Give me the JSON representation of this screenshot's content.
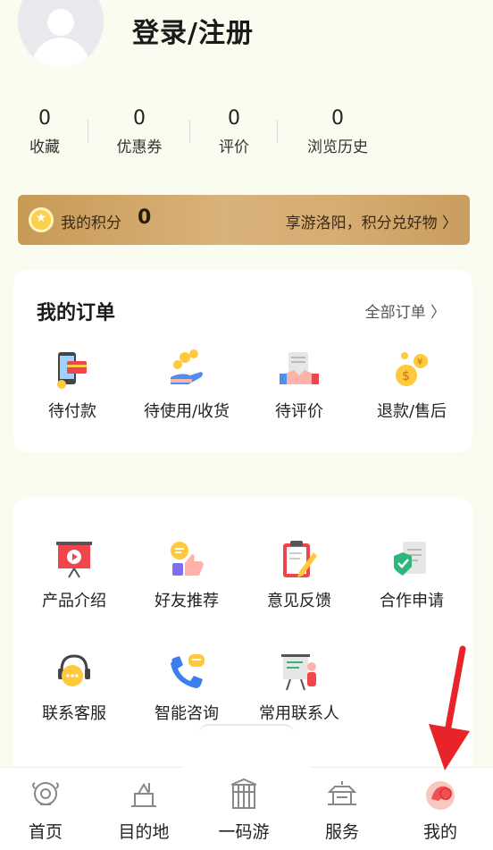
{
  "header": {
    "title": "登录/注册"
  },
  "stats": [
    {
      "value": "0",
      "label": "收藏"
    },
    {
      "value": "0",
      "label": "优惠券"
    },
    {
      "value": "0",
      "label": "评价"
    },
    {
      "value": "0",
      "label": "浏览历史"
    }
  ],
  "points": {
    "label": "我的积分",
    "value": "0",
    "promo": "享游洛阳，积分兑好物 〉"
  },
  "orders": {
    "title": "我的订单",
    "all_label": "全部订单 〉",
    "items": [
      {
        "label": "待付款",
        "icon": "pending-payment-icon"
      },
      {
        "label": "待使用/收货",
        "icon": "to-use-icon"
      },
      {
        "label": "待评价",
        "icon": "to-review-icon"
      },
      {
        "label": "退款/售后",
        "icon": "refund-icon"
      }
    ]
  },
  "services": {
    "items": [
      {
        "label": "产品介绍",
        "icon": "product-intro-icon"
      },
      {
        "label": "好友推荐",
        "icon": "friend-recommend-icon"
      },
      {
        "label": "意见反馈",
        "icon": "feedback-icon"
      },
      {
        "label": "合作申请",
        "icon": "cooperation-icon"
      },
      {
        "label": "联系客服",
        "icon": "customer-service-icon"
      },
      {
        "label": "智能咨询",
        "icon": "smart-consult-icon"
      },
      {
        "label": "常用联系人",
        "icon": "contacts-icon"
      }
    ]
  },
  "tabbar": [
    {
      "label": "首页",
      "icon": "home-icon"
    },
    {
      "label": "目的地",
      "icon": "destination-icon"
    },
    {
      "label": "一码游",
      "icon": "qr-tour-icon"
    },
    {
      "label": "服务",
      "icon": "service-icon"
    },
    {
      "label": "我的",
      "icon": "mine-icon",
      "active": true
    }
  ],
  "colors": {
    "accent": "#e8343a",
    "gold": "#c99d5e",
    "background": "#fafcf0"
  }
}
